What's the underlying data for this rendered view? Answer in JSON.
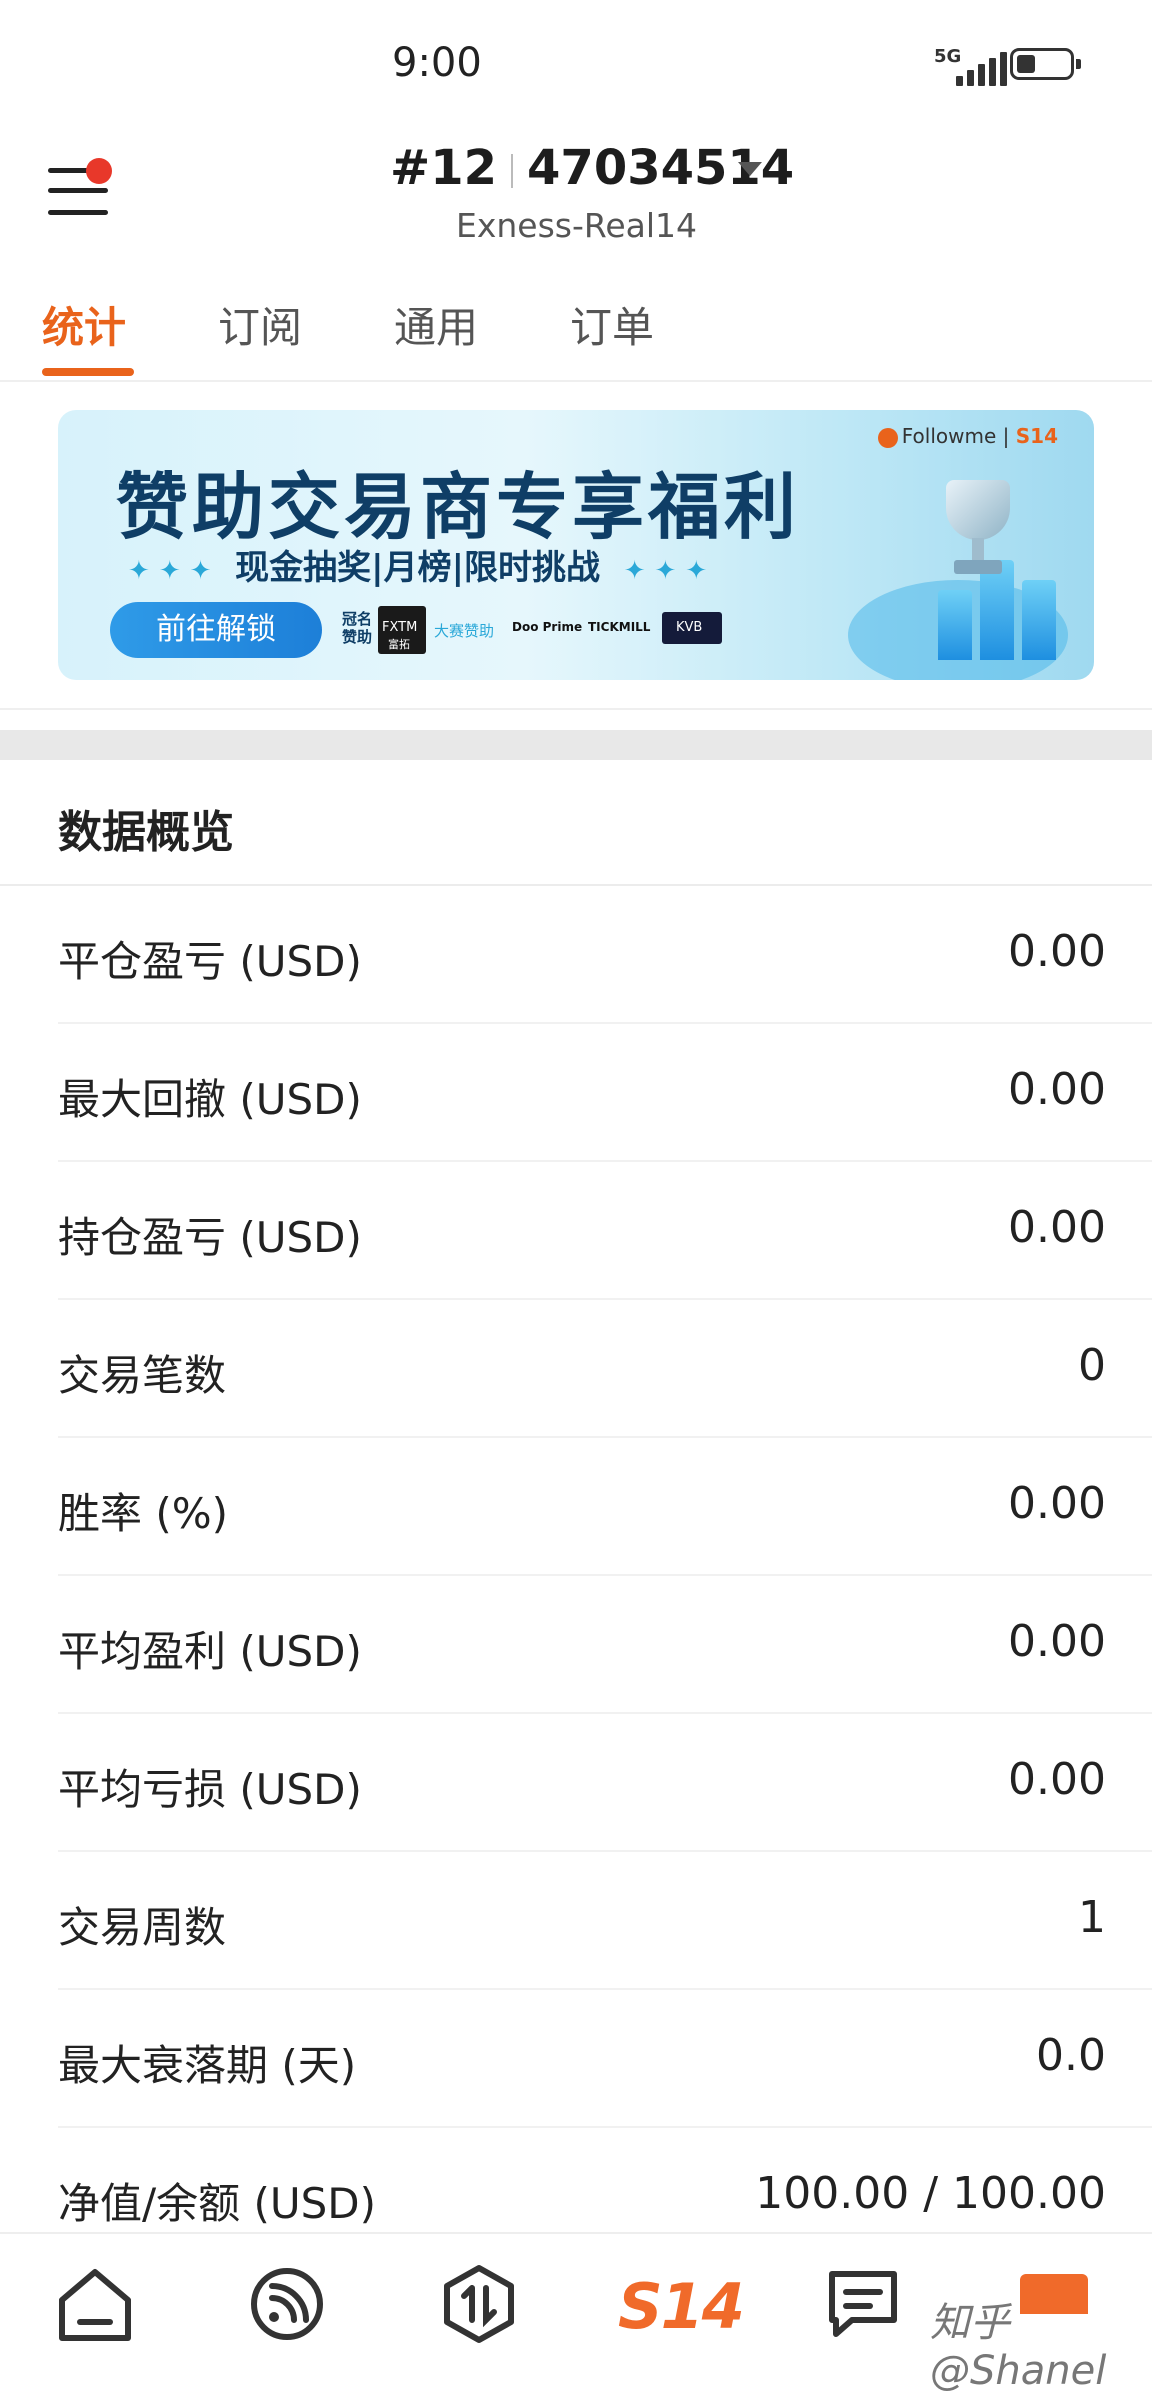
{
  "status_bar": {
    "time": "9:00",
    "network": "5G"
  },
  "header": {
    "account_prefix": "#12",
    "account_number": "47034514",
    "server": "Exness-Real14"
  },
  "tabs": [
    {
      "label": "统计",
      "active": true
    },
    {
      "label": "订阅",
      "active": false
    },
    {
      "label": "通用",
      "active": false
    },
    {
      "label": "订单",
      "active": false
    }
  ],
  "banner": {
    "brand": "Followme",
    "brand_tag": "S14",
    "title": "赞助交易商专享福利",
    "subtitle": "现金抽奖|月榜|限时挑战",
    "button": "前往解锁",
    "title_sponsor_label": "冠名赞助",
    "title_sponsor": "FXTM",
    "title_sponsor_cn": "富拓",
    "event_sponsor_label": "大赛赞助",
    "event_sponsors": [
      "Doo Prime",
      "TICKMILL",
      "KVB"
    ]
  },
  "overview": {
    "title": "数据概览",
    "rows": [
      {
        "label": "平仓盈亏 (USD)",
        "value": "0.00"
      },
      {
        "label": "最大回撤 (USD)",
        "value": "0.00"
      },
      {
        "label": "持仓盈亏 (USD)",
        "value": "0.00"
      },
      {
        "label": "交易笔数",
        "value": "0"
      },
      {
        "label": "胜率 (%)",
        "value": "0.00"
      },
      {
        "label": "平均盈利 (USD)",
        "value": "0.00"
      },
      {
        "label": "平均亏损 (USD)",
        "value": "0.00"
      },
      {
        "label": "交易周数",
        "value": "1"
      },
      {
        "label": "最大衰落期 (天)",
        "value": "0.0"
      },
      {
        "label": "净值/余额 (USD)",
        "value": "100.00 / 100.00"
      }
    ]
  },
  "bottom_nav": {
    "items": [
      "home-icon",
      "feed-icon",
      "trade-icon",
      "s14",
      "chat-icon",
      "profile-icon"
    ],
    "s14_label": "S14",
    "watermark": "知乎 @Shanel"
  },
  "colors": {
    "accent": "#e9631b",
    "banner_dark": "#0f3e66",
    "badge": "#e8382a"
  }
}
